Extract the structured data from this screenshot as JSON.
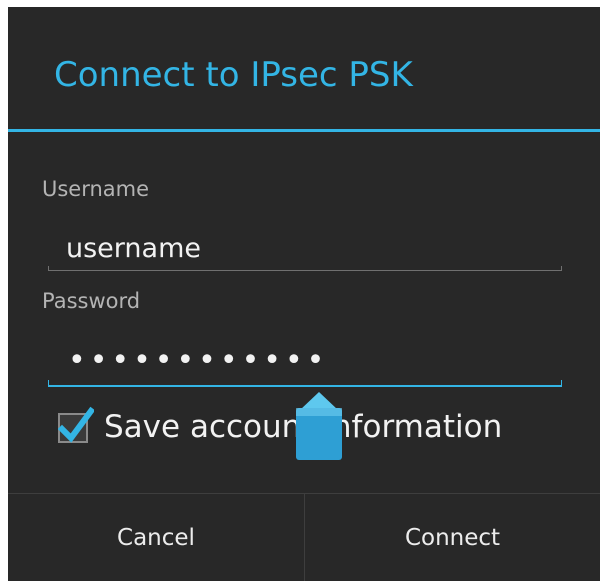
{
  "dialog": {
    "title": "Connect to IPsec PSK"
  },
  "form": {
    "username_label": "Username",
    "username_value": "username",
    "password_label": "Password",
    "password_masked": "••••••••••••",
    "save_checked": true,
    "save_label": "Save account information"
  },
  "buttons": {
    "cancel": "Cancel",
    "connect": "Connect"
  },
  "colors": {
    "accent": "#33b5e5",
    "background": "#282828"
  }
}
